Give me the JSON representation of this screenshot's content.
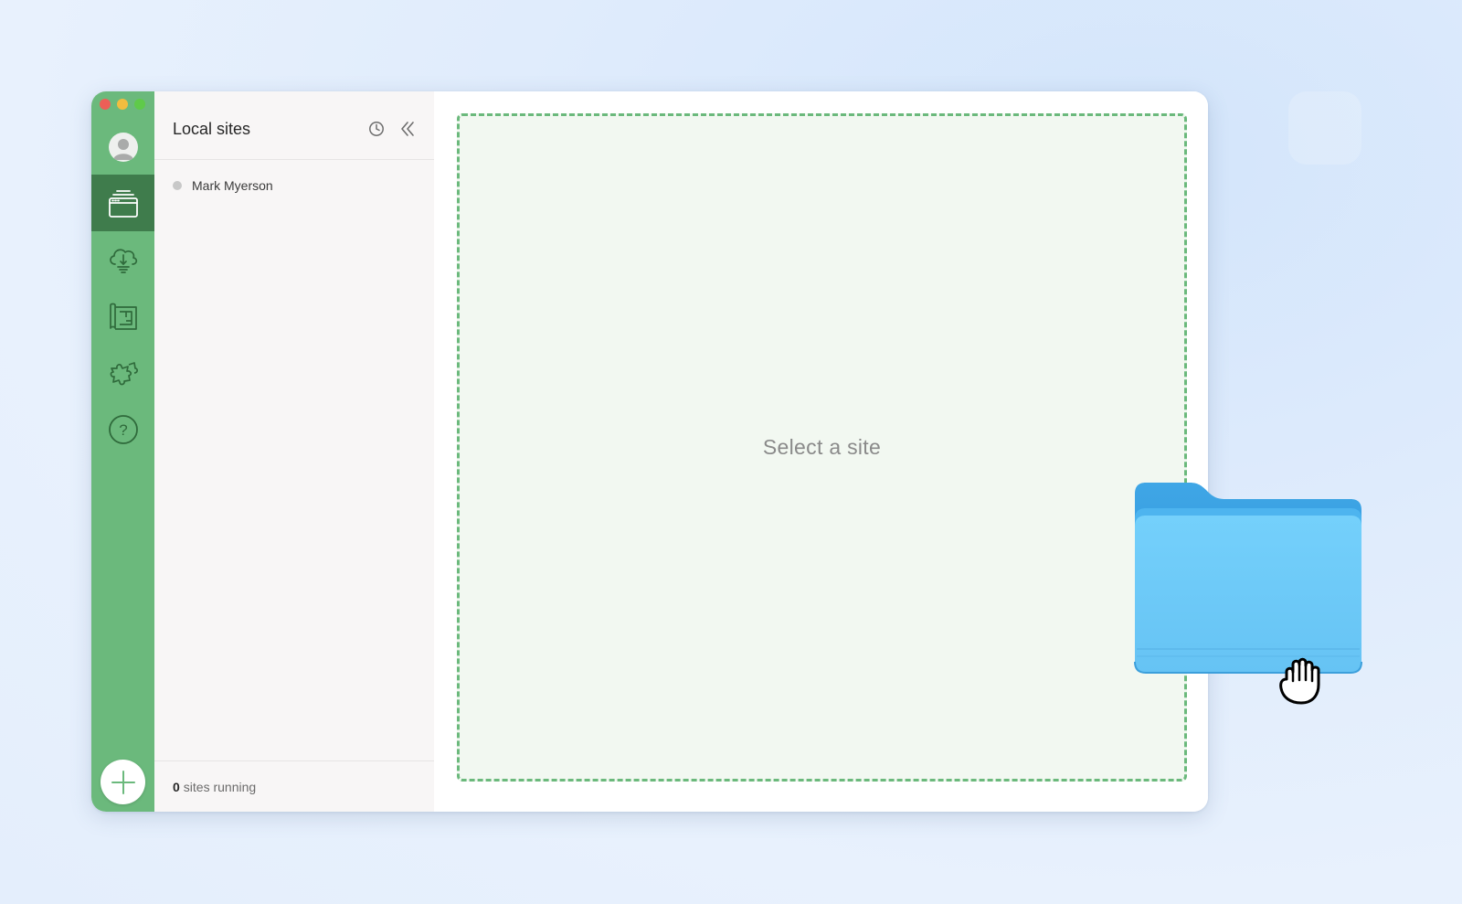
{
  "window": {
    "controls": [
      "close",
      "minimize",
      "maximize"
    ]
  },
  "rail": {
    "items": [
      {
        "name": "avatar",
        "icon": "user-avatar-icon"
      },
      {
        "name": "local-sites",
        "icon": "browser-window-icon",
        "active": true
      },
      {
        "name": "connect",
        "icon": "cloud-icon"
      },
      {
        "name": "blueprints",
        "icon": "blueprint-icon"
      },
      {
        "name": "add-ons",
        "icon": "puzzle-icon"
      },
      {
        "name": "help",
        "icon": "help-icon"
      }
    ],
    "add_button_icon": "plus-icon"
  },
  "sites_panel": {
    "title": "Local sites",
    "sites": [
      {
        "name": "Mark Myerson",
        "status": "stopped"
      }
    ],
    "footer": {
      "count": "0",
      "label": "sites running"
    }
  },
  "main": {
    "placeholder": "Select a site"
  },
  "overlay": {
    "folder_icon": "folder-icon",
    "cursor_icon": "grab-hand-cursor-icon"
  },
  "colors": {
    "rail_green": "#6bb97c",
    "rail_active": "#3f7c4c",
    "dropzone_border": "#6bb97c",
    "dropzone_fill": "#f2f8f1",
    "folder_blue": "#6ccaf7"
  }
}
